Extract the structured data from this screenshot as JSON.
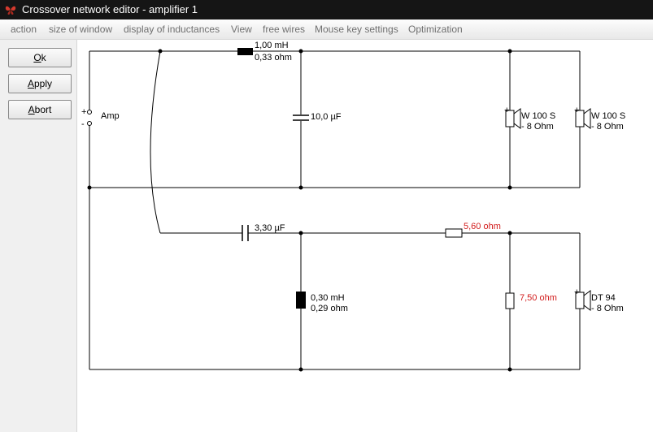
{
  "window": {
    "title": "Crossover network editor - amplifier 1",
    "app_icon": "butterfly-icon"
  },
  "menu": [
    "action",
    "size of window",
    "display of inductances",
    "View",
    "free wires",
    "Mouse key settings",
    "Optimization"
  ],
  "buttons": {
    "ok": {
      "mnemonic": "O",
      "rest": "k"
    },
    "apply": {
      "mnemonic": "A",
      "rest": "pply"
    },
    "abort": {
      "mnemonic": "A",
      "rest": "bort"
    }
  },
  "schematic": {
    "amp": {
      "plus": "+",
      "minus": "-",
      "label": "Amp"
    },
    "inductor_top": {
      "value": "1,00 mH",
      "resistance": "0,33 ohm"
    },
    "capacitor_top": {
      "value": "10,0 µF"
    },
    "speaker_1": {
      "plus": "+",
      "name": "W 100 S",
      "impedance": "- 8 Ohm"
    },
    "speaker_2": {
      "plus": "+",
      "name": "W 100 S",
      "impedance": "- 8 Ohm"
    },
    "capacitor_bottom": {
      "value": "3,30 µF"
    },
    "resistor_series": {
      "value": "5,60 ohm"
    },
    "inductor_bottom": {
      "value": "0,30 mH",
      "resistance": "0,29 ohm"
    },
    "resistor_shunt": {
      "value": "7,50 ohm"
    },
    "speaker_3": {
      "plus": "+",
      "name": "DT 94",
      "impedance": "- 8 Ohm"
    }
  },
  "colors": {
    "wire": "#000000",
    "highlight_value": "#d21c1c",
    "titlebar": "#151515",
    "panel": "#f0f0f0"
  }
}
